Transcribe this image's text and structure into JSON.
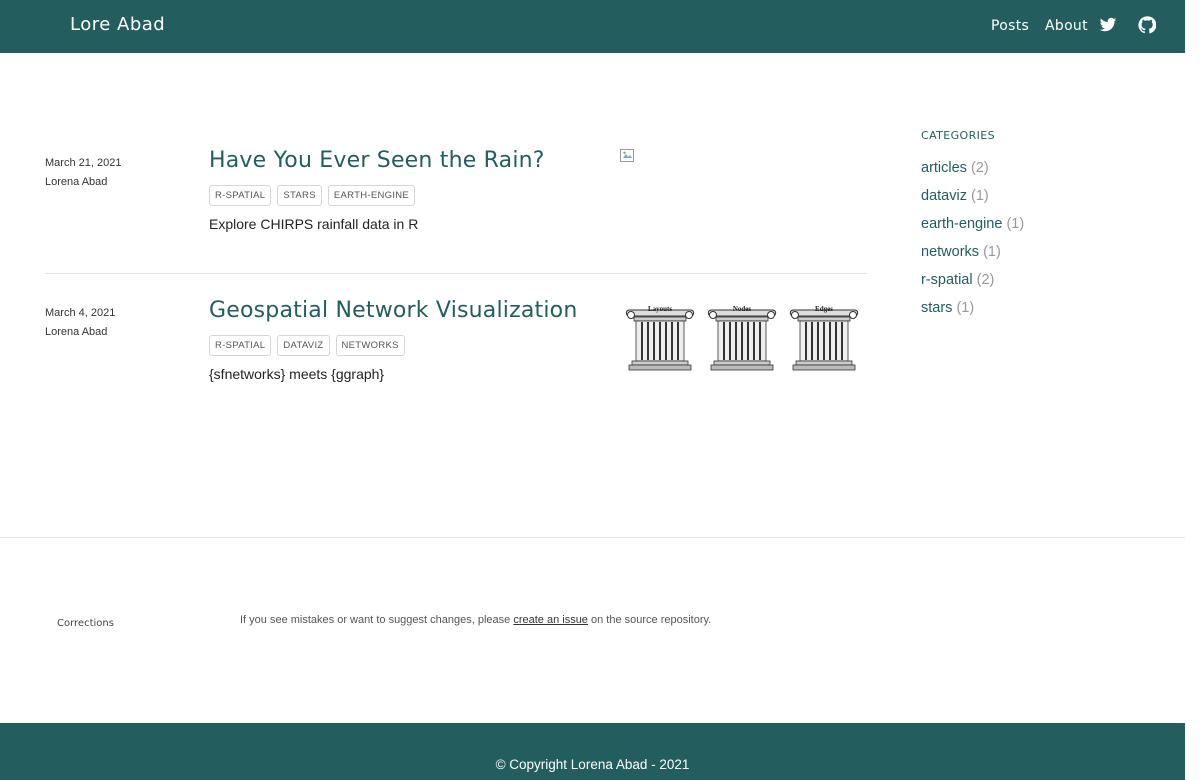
{
  "header": {
    "site_title": "Lore Abad",
    "nav": {
      "posts": "Posts",
      "about": "About"
    },
    "icons": [
      "twitter-icon",
      "github-icon"
    ]
  },
  "posts": [
    {
      "date": "March 21, 2021",
      "author": "Lorena Abad",
      "title": "Have You Ever Seen the Rain?",
      "tags": [
        "R-SPATIAL",
        "STARS",
        "EARTH-ENGINE"
      ],
      "description": "Explore CHIRPS rainfall data in R"
    },
    {
      "date": "March 4, 2021",
      "author": "Lorena Abad",
      "title": "Geospatial Network Visualization",
      "tags": [
        "R-SPATIAL",
        "DATAVIZ",
        "NETWORKS"
      ],
      "description": "{sfnetworks} meets {ggraph}",
      "thumbnail_labels": [
        "Layouts",
        "Nodes",
        "Edges"
      ]
    }
  ],
  "sidebar": {
    "heading": "CATEGORIES",
    "categories": [
      {
        "name": "articles",
        "count": "(2)"
      },
      {
        "name": "dataviz",
        "count": "(1)"
      },
      {
        "name": "earth-engine",
        "count": "(1)"
      },
      {
        "name": "networks",
        "count": "(1)"
      },
      {
        "name": "r-spatial",
        "count": "(2)"
      },
      {
        "name": "stars",
        "count": "(1)"
      }
    ]
  },
  "corrections": {
    "label": "Corrections",
    "text_before": "If you see mistakes or want to suggest changes, please ",
    "link_text": "create an issue",
    "text_after": " on the source repository."
  },
  "footer": {
    "text": "© Copyright Lorena Abad - 2021"
  },
  "colors": {
    "accent": "#245d5e",
    "divider": "#e4e4e4"
  }
}
